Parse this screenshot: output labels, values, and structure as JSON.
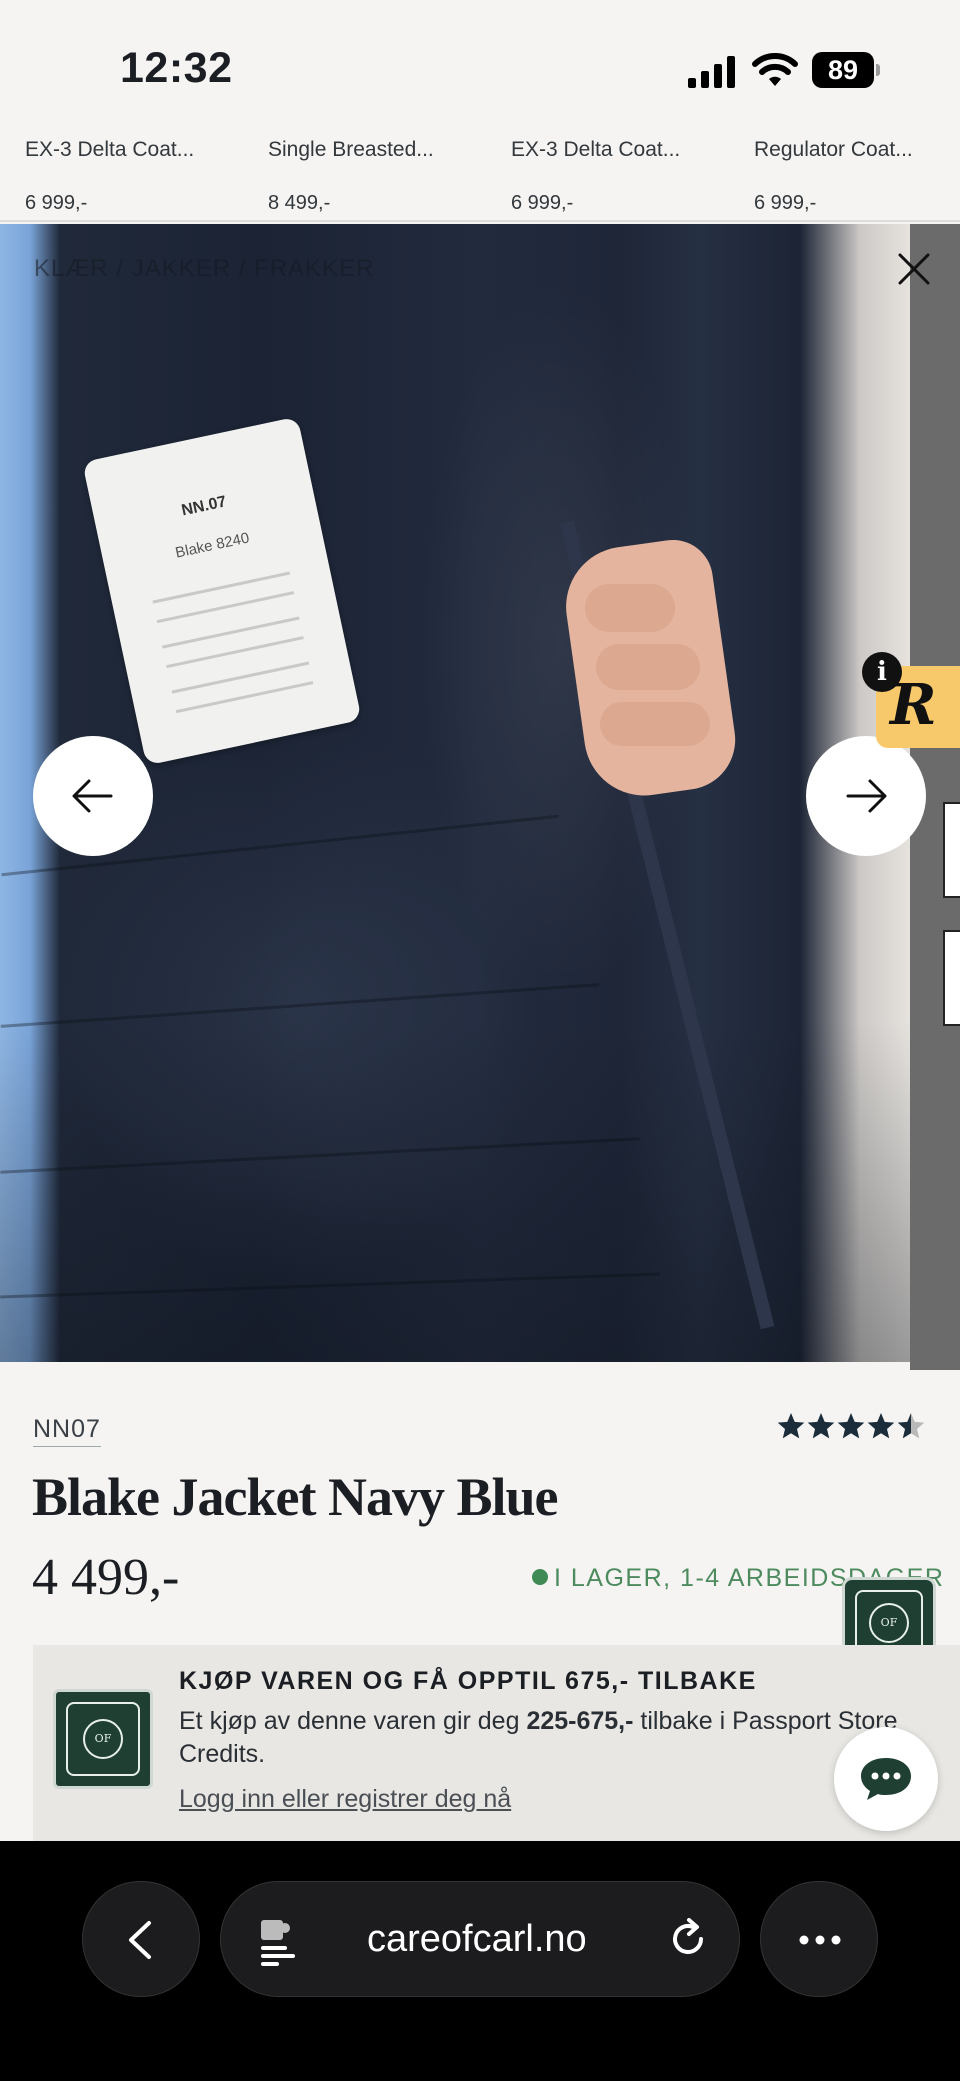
{
  "status_bar": {
    "time": "12:32",
    "battery": "89"
  },
  "recent_products": [
    {
      "name": "EX-3 Delta Coat...",
      "price": "6 999,-"
    },
    {
      "name": "Single Breasted...",
      "price": "8 499,-"
    },
    {
      "name": "EX-3 Delta Coat...",
      "price": "6 999,-"
    },
    {
      "name": "Regulator Coat...",
      "price": "6 999,-"
    }
  ],
  "gallery": {
    "breadcrumb": "KLÆR / JAKKER / FRAKKER",
    "label_brand": "NN.07",
    "label_model": "Blake 8240"
  },
  "product": {
    "brand": "NN07",
    "title": "Blake Jacket Navy Blue",
    "price": "4 499,-",
    "stock": "I LAGER, 1-4 ARBEIDSDAGER",
    "rating": 4.5,
    "rating_max": 5
  },
  "promo": {
    "title": "KJØP VAREN OG FÅ OPPTIL 675,- TILBAKE",
    "text_before": "Et kjøp av denne varen gir deg ",
    "text_bold": "225-675,-",
    "text_after": " tilbake i Passport Store Credits.",
    "link": "Logg inn eller registrer deg nå",
    "logo_text": "OF"
  },
  "widgets": {
    "r_badge_letter": "R",
    "info_letter": "i"
  },
  "browser": {
    "url": "careofcarl.no"
  },
  "colors": {
    "stock_green": "#4d8b5f",
    "badge_green": "#1f3f33",
    "badge_yellow": "#f7c96a"
  }
}
